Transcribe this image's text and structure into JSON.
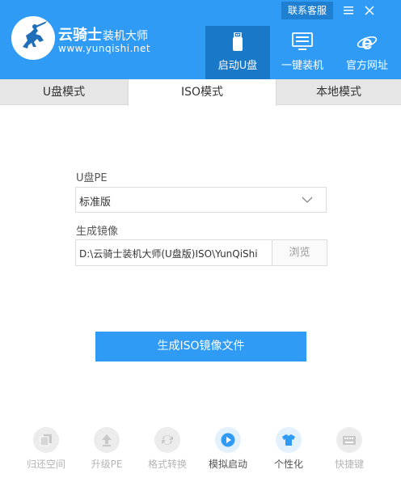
{
  "brand": {
    "name": "云骑士",
    "name_suffix": "装机大师",
    "url": "www.yunqishi.net"
  },
  "window": {
    "contact_label": "联系客服",
    "minimize_icon": "menu-icon",
    "close_icon": "close-icon"
  },
  "nav": [
    {
      "label": "启动U盘",
      "icon": "usb-drive-icon",
      "active": true
    },
    {
      "label": "一键装机",
      "icon": "monitor-icon",
      "active": false
    },
    {
      "label": "官方网址",
      "icon": "ie-browser-icon",
      "active": false
    }
  ],
  "tabs": [
    {
      "label": "U盘模式",
      "active": false
    },
    {
      "label": "ISO模式",
      "active": true
    },
    {
      "label": "本地模式",
      "active": false
    }
  ],
  "form": {
    "pe_label": "U盘PE",
    "pe_value": "标准版",
    "image_label": "生成镜像",
    "image_path": "D:\\云骑士装机大师(U盘版)ISO\\YunQiShi",
    "browse_label": "浏览",
    "generate_label": "生成ISO镜像文件"
  },
  "toolbar": [
    {
      "label": "归还空间",
      "icon": "copy-icon",
      "active": false
    },
    {
      "label": "升级PE",
      "icon": "upgrade-icon",
      "active": false
    },
    {
      "label": "格式转换",
      "icon": "convert-icon",
      "active": false
    },
    {
      "label": "模拟启动",
      "icon": "play-icon",
      "active": true
    },
    {
      "label": "个性化",
      "icon": "shirt-icon",
      "active": true
    },
    {
      "label": "快捷键",
      "icon": "keyboard-icon",
      "active": false
    }
  ],
  "colors": {
    "accent": "#2f9bf5",
    "accent_dark": "#1a78c9",
    "tab_bg": "#e6e6e6",
    "disabled_text": "#b5b5b5"
  }
}
